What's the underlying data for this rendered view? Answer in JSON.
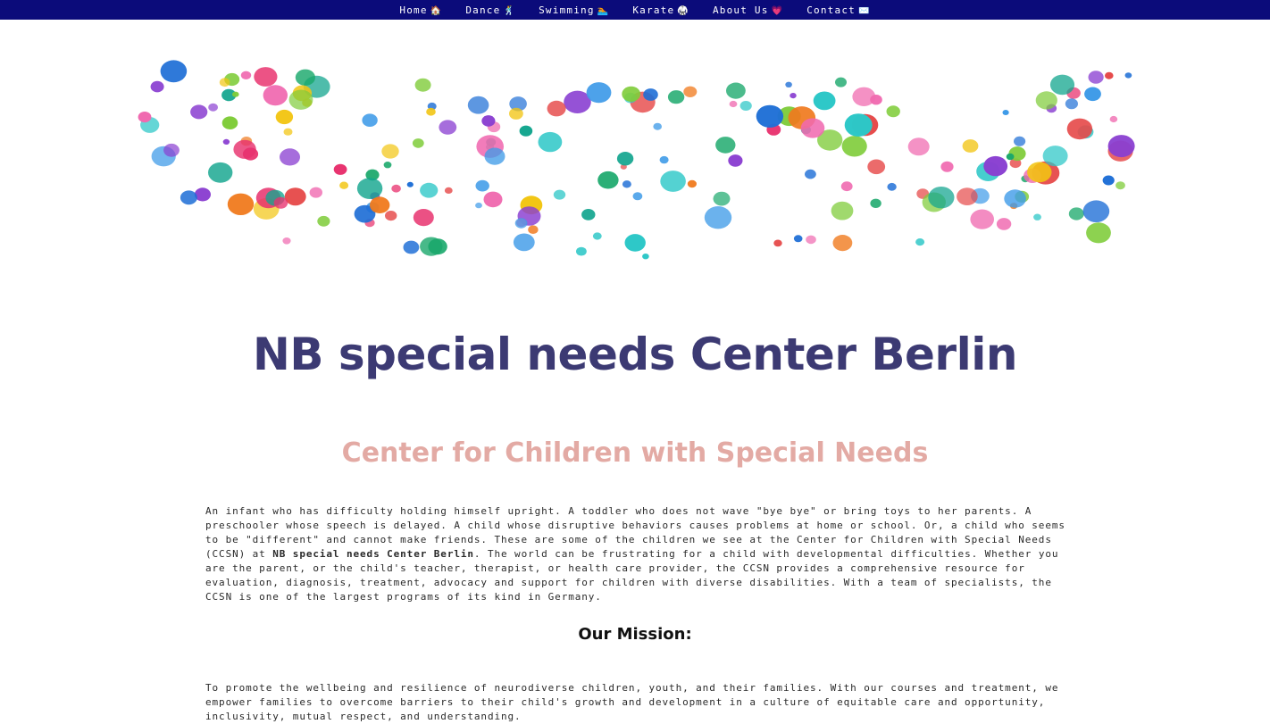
{
  "nav": {
    "items": [
      {
        "label": "Home",
        "icon": "house-icon",
        "glyph": "🏠"
      },
      {
        "label": "Dance",
        "icon": "dancer-icon",
        "glyph": "🕺"
      },
      {
        "label": "Swimming",
        "icon": "swimmer-icon",
        "glyph": "🏊"
      },
      {
        "label": "Karate",
        "icon": "martial-arts-icon",
        "glyph": "🥋"
      },
      {
        "label": "About Us",
        "icon": "heart-icon",
        "glyph": "💗"
      },
      {
        "label": "Contact",
        "icon": "envelope-icon",
        "glyph": "✉️"
      }
    ]
  },
  "hero": {
    "title": "NB special needs Center Berlin",
    "subtitle": "Center for Children with Special Needs"
  },
  "intro": {
    "text_before": "An infant who has difficulty holding himself upright. A toddler who does not wave \"bye bye\" or bring toys to her parents. A preschooler whose speech is delayed. A child whose disruptive behaviors causes problems at home or school. Or, a child who seems to be \"different\" and cannot make friends. These are some of the children we see at the Center for Children with Special Needs (CCSN) at ",
    "bold_text": "NB special needs Center Berlin",
    "text_after": ". The world can be frustrating for a child with developmental difficulties. Whether you are the parent, or the child's teacher, therapist, or health care provider, the CCSN provides a comprehensive resource for evaluation, diagnosis, treatment, advocacy and support for children with diverse disabilities. With a team of specialists, the CCSN is one of the largest programs of its kind in Germany."
  },
  "mission": {
    "heading": "Our Mission:",
    "text": "To promote the wellbeing and resilience of neurodiverse children, youth, and their families. With our courses and treatment, we empower families to overcome barriers to their child's growth and development in a culture of equitable care and opportunity, inclusivity, mutual respect, and understanding."
  },
  "colors": {
    "nav_bg": "#0b0b7a",
    "title": "#3c3a73",
    "subtitle": "#e3aaa4"
  }
}
